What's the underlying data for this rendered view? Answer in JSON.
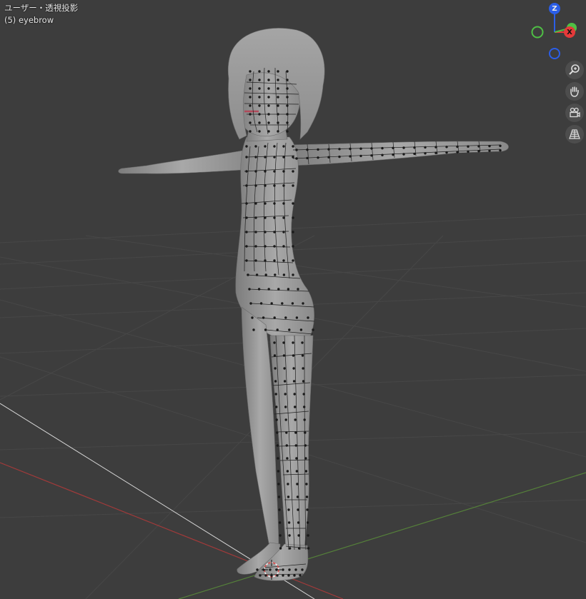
{
  "viewport": {
    "view_label": "ユーザー・透視投影",
    "object_label": "(5) eyebrow"
  },
  "gizmo": {
    "axes": [
      {
        "key": "z",
        "label": "Z",
        "color": "#2b5ee8"
      },
      {
        "key": "x",
        "label": "X",
        "color": "#e53a3a"
      },
      {
        "key": "y",
        "label": "",
        "color": "#4fbf45"
      }
    ]
  },
  "nav_tools": [
    {
      "name": "zoom-view-button",
      "icon": "magnifier-plus-icon"
    },
    {
      "name": "pan-view-button",
      "icon": "hand-icon"
    },
    {
      "name": "camera-view-button",
      "icon": "camera-icon"
    },
    {
      "name": "perspective-toggle-button",
      "icon": "grid-perspective-icon"
    }
  ],
  "colors": {
    "background": "#3d3d3d",
    "grid": "#4a4a4a",
    "x_axis": "#b03a3a",
    "y_axis": "#5a8a3a",
    "mesh": "#9a9a9a",
    "wire": "#1e1e1e"
  }
}
